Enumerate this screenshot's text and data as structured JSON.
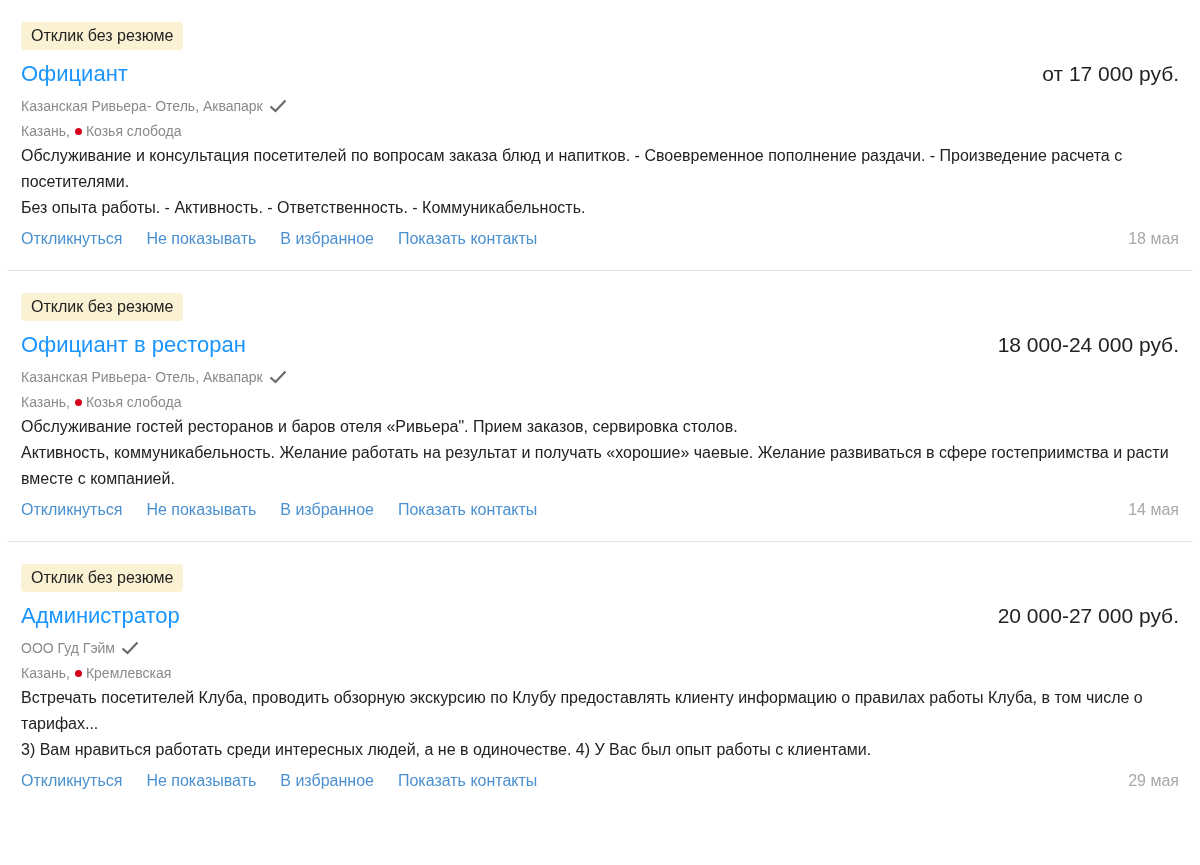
{
  "vacancies": [
    {
      "badge": "Отклик без резюме",
      "title": "Официант",
      "salary": "от 17 000 руб.",
      "company": "Казанская Ривьера- Отель, Аквапарк",
      "verified": true,
      "city": "Казань,",
      "metro": {
        "name": "Козья слобода",
        "color": "#d6001c"
      },
      "description": [
        "Обслуживание и консультация посетителей по вопросам заказа блюд и напитков. - Своевременное пополнение раздачи. - Произведение расчета с посетителями.",
        "Без опыта работы. - Активность. - Ответственность. - Коммуникабельность."
      ],
      "actions": [
        "Откликнуться",
        "Не показывать",
        "В избранное",
        "Показать контакты"
      ],
      "date": "18 мая"
    },
    {
      "badge": "Отклик без резюме",
      "title": "Официант в ресторан",
      "salary": "18 000-24 000 руб.",
      "company": "Казанская Ривьера- Отель, Аквапарк",
      "verified": true,
      "city": "Казань,",
      "metro": {
        "name": "Козья слобода",
        "color": "#d6001c"
      },
      "description": [
        "Обслуживание гостей ресторанов и баров отеля «Ривьера\". Прием заказов, сервировка столов.",
        "Активность, коммуникабельность. Желание работать на результат и получать «хорошие» чаевые. Желание развиваться в сфере гостеприимства и расти вместе с компанией."
      ],
      "actions": [
        "Откликнуться",
        "Не показывать",
        "В избранное",
        "Показать контакты"
      ],
      "date": "14 мая"
    },
    {
      "badge": "Отклик без резюме",
      "title": "Администратор",
      "salary": "20 000-27 000 руб.",
      "company": "ООО Гуд Гэйм",
      "verified": true,
      "city": "Казань,",
      "metro": {
        "name": "Кремлевская",
        "color": "#d6001c"
      },
      "description": [
        "Встречать посетителей Клуба, проводить обзорную экскурсию по Клубу предоставлять клиенту информацию о правилах работы Клуба, в том числе о тарифах...",
        "3) Вам нравиться работать среди интересных людей, а не в одиночестве. 4) У Вас был опыт работы с клиентами."
      ],
      "actions": [
        "Откликнуться",
        "Не показывать",
        "В избранное",
        "Показать контакты"
      ],
      "date": "29 мая"
    }
  ]
}
